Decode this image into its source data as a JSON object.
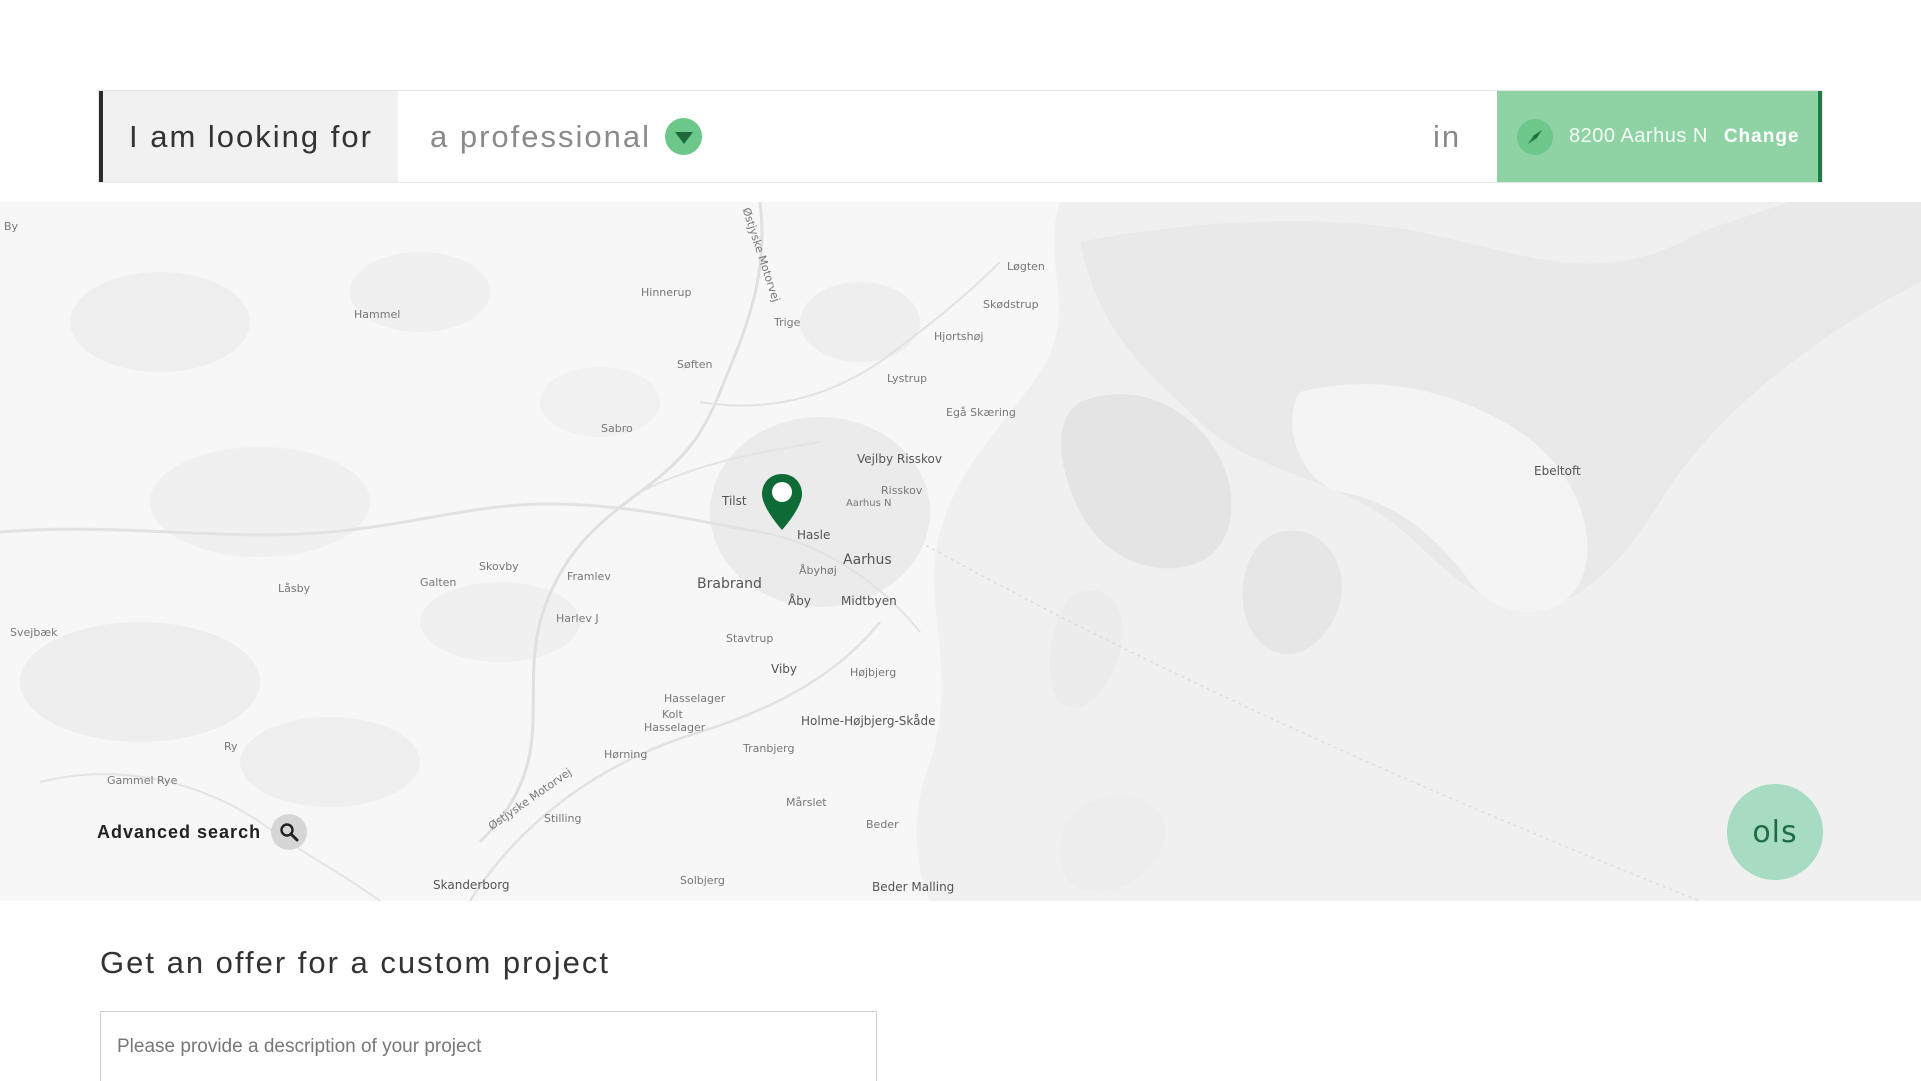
{
  "search": {
    "prefix": "I am looking for",
    "category_value": "a professional",
    "in_label": "in",
    "location": "8200 Aarhus N",
    "change_label": "Change"
  },
  "map": {
    "places": [
      "By",
      "Hinnerup",
      "Løgten",
      "Skødstrup",
      "Hammel",
      "Trige",
      "Hjortshøj",
      "Søften",
      "Lystrup",
      "Egå Skæring",
      "Sabro",
      "Vejlby Risskov",
      "Risskov",
      "Tilst",
      "Aarhus N",
      "Hasle",
      "Aarhus",
      "Åbyhøj",
      "Brabrand",
      "Skovby",
      "Framlev",
      "Galten",
      "Låsby",
      "Åby",
      "Midtbyen",
      "Harlev J",
      "Svejbæk",
      "Stavtrup",
      "Viby",
      "Højbjerg",
      "Hasselager",
      "Kolt",
      "Hasselager",
      "Holme-Højbjerg-Skåde",
      "Hørning",
      "Tranbjerg",
      "Ry",
      "Gammel Rye",
      "Mårslet",
      "Beder",
      "Stilling",
      "Østjyske Motorvej",
      "Skanderborg",
      "Solbjerg",
      "Beder Malling",
      "Ebeltoft",
      "Østjyske Motorvej"
    ],
    "pin_icon": "map-pin-icon"
  },
  "advanced_search": {
    "label": "Advanced search",
    "icon": "search-icon"
  },
  "brand": {
    "text": "ols"
  },
  "offer": {
    "title": "Get an offer for a custom project",
    "placeholder": "Please provide a description of your project"
  },
  "colors": {
    "accent": "#8fd3a4",
    "accent_dark": "#1f7a45",
    "pin": "#0e6b35",
    "badge": "#a7dcc2"
  }
}
